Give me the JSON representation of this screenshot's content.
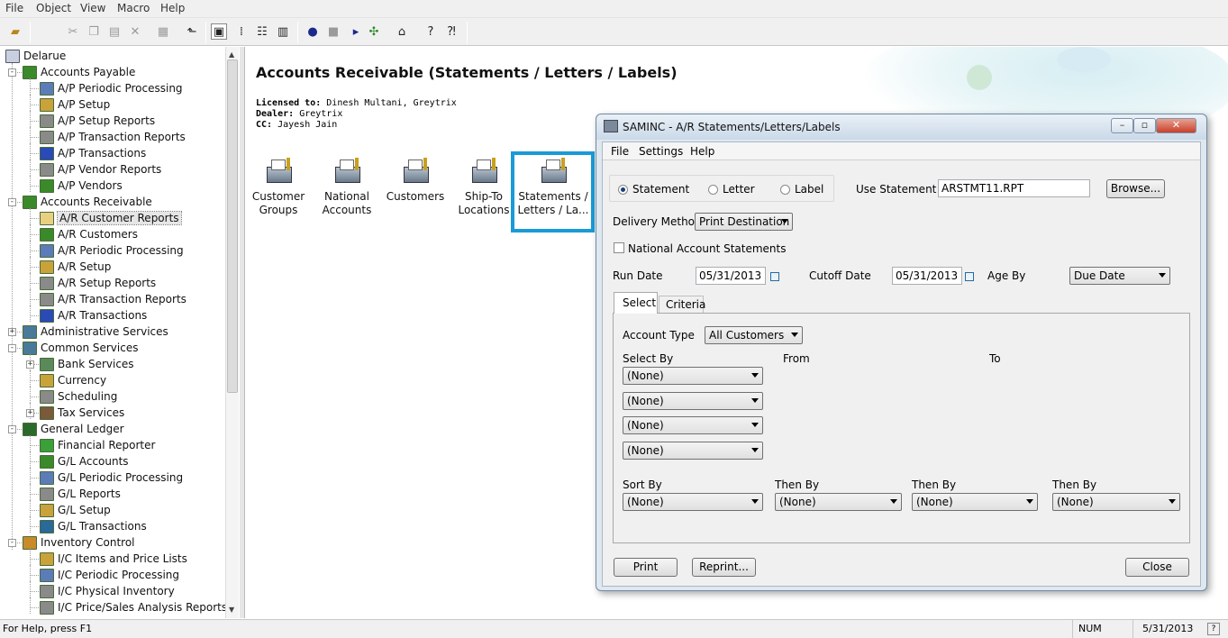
{
  "menubar": [
    "File",
    "Object",
    "View",
    "Macro",
    "Help"
  ],
  "tree": {
    "root": "Delarue",
    "items": [
      {
        "label": "Accounts Payable",
        "level": 1,
        "exp": "-",
        "color": "#3a8a2a"
      },
      {
        "label": "A/P Periodic Processing",
        "level": 2,
        "color": "#5b7cb8"
      },
      {
        "label": "A/P Setup",
        "level": 2,
        "color": "#c9a23a"
      },
      {
        "label": "A/P Setup Reports",
        "level": 2,
        "color": "#8a8a8a"
      },
      {
        "label": "A/P Transaction Reports",
        "level": 2,
        "color": "#8a8a8a"
      },
      {
        "label": "A/P Transactions",
        "level": 2,
        "color": "#2a4ab8"
      },
      {
        "label": "A/P Vendor Reports",
        "level": 2,
        "color": "#8a8a8a"
      },
      {
        "label": "A/P Vendors",
        "level": 2,
        "color": "#3a8a2a"
      },
      {
        "label": "Accounts Receivable",
        "level": 1,
        "exp": "-",
        "color": "#3a8a2a"
      },
      {
        "label": "A/R Customer Reports",
        "level": 2,
        "color": "#e8d080",
        "selected": true
      },
      {
        "label": "A/R Customers",
        "level": 2,
        "color": "#3a8a2a"
      },
      {
        "label": "A/R Periodic Processing",
        "level": 2,
        "color": "#5b7cb8"
      },
      {
        "label": "A/R Setup",
        "level": 2,
        "color": "#c9a23a"
      },
      {
        "label": "A/R Setup Reports",
        "level": 2,
        "color": "#8a8a8a"
      },
      {
        "label": "A/R Transaction Reports",
        "level": 2,
        "color": "#8a8a8a"
      },
      {
        "label": "A/R Transactions",
        "level": 2,
        "color": "#2a4ab8"
      },
      {
        "label": "Administrative Services",
        "level": 1,
        "exp": "+",
        "color": "#4a7a9a"
      },
      {
        "label": "Common Services",
        "level": 1,
        "exp": "-",
        "color": "#4a7a9a"
      },
      {
        "label": "Bank Services",
        "level": 2,
        "exp": "+",
        "color": "#5a8a5a"
      },
      {
        "label": "Currency",
        "level": 2,
        "color": "#c9a23a"
      },
      {
        "label": "Scheduling",
        "level": 2,
        "color": "#8a8a8a"
      },
      {
        "label": "Tax Services",
        "level": 2,
        "exp": "+",
        "color": "#7a5a3a"
      },
      {
        "label": "General Ledger",
        "level": 1,
        "exp": "-",
        "color": "#2a6a2a"
      },
      {
        "label": "Financial Reporter",
        "level": 2,
        "color": "#3aa03a"
      },
      {
        "label": "G/L Accounts",
        "level": 2,
        "color": "#3a8a2a"
      },
      {
        "label": "G/L Periodic Processing",
        "level": 2,
        "color": "#5b7cb8"
      },
      {
        "label": "G/L Reports",
        "level": 2,
        "color": "#8a8a8a"
      },
      {
        "label": "G/L Setup",
        "level": 2,
        "color": "#c9a23a"
      },
      {
        "label": "G/L Transactions",
        "level": 2,
        "color": "#2a6a9a"
      },
      {
        "label": "Inventory Control",
        "level": 1,
        "exp": "-",
        "color": "#c98a2a"
      },
      {
        "label": "I/C Items and Price Lists",
        "level": 2,
        "color": "#c9a23a"
      },
      {
        "label": "I/C Periodic Processing",
        "level": 2,
        "color": "#5b7cb8"
      },
      {
        "label": "I/C Physical Inventory",
        "level": 2,
        "color": "#8a8a8a"
      },
      {
        "label": "I/C Price/Sales Analysis Reports",
        "level": 2,
        "color": "#8a8a8a"
      }
    ]
  },
  "main": {
    "title": "Accounts Receivable (Statements / Letters / Labels)",
    "licensed_label": "Licensed to:",
    "licensed_value": "Dinesh Multani, Greytrix",
    "dealer_label": "Dealer:",
    "dealer_value": "Greytrix",
    "cc_label": "CC:",
    "cc_value": "Jayesh Jain",
    "icons": [
      {
        "line1": "Customer",
        "line2": "Groups"
      },
      {
        "line1": "National",
        "line2": "Accounts"
      },
      {
        "line1": "Customers",
        "line2": ""
      },
      {
        "line1": "Ship-To",
        "line2": "Locations"
      },
      {
        "line1": "Statements /",
        "line2": "Letters / La..."
      }
    ]
  },
  "dialog": {
    "title": "SAMINC - A/R Statements/Letters/Labels",
    "menu": [
      "File",
      "Settings",
      "Help"
    ],
    "radio_statement": "Statement",
    "radio_letter": "Letter",
    "radio_label": "Label",
    "use_statement_label": "Use Statement",
    "use_statement_value": "ARSTMT11.RPT",
    "browse": "Browse...",
    "delivery_label": "Delivery Method",
    "delivery_value": "Print Destination",
    "national_label": "National Account Statements",
    "run_date_label": "Run Date",
    "run_date": "05/31/2013",
    "cutoff_label": "Cutoff Date",
    "cutoff_date": "05/31/2013",
    "age_by_label": "Age By",
    "age_by_value": "Due Date",
    "tab_select": "Select",
    "tab_criteria": "Criteria",
    "account_type_label": "Account Type",
    "account_type_value": "All Customers",
    "select_by_label": "Select By",
    "from_label": "From",
    "to_label": "To",
    "select_by": [
      "(None)",
      "(None)",
      "(None)",
      "(None)"
    ],
    "sort_by_label": "Sort By",
    "then_by_label": "Then By",
    "sort": [
      "(None)",
      "(None)",
      "(None)",
      "(None)"
    ],
    "print": "Print",
    "reprint": "Reprint...",
    "close": "Close"
  },
  "status": {
    "help": "For Help, press F1",
    "num": "NUM",
    "date": "5/31/2013"
  }
}
